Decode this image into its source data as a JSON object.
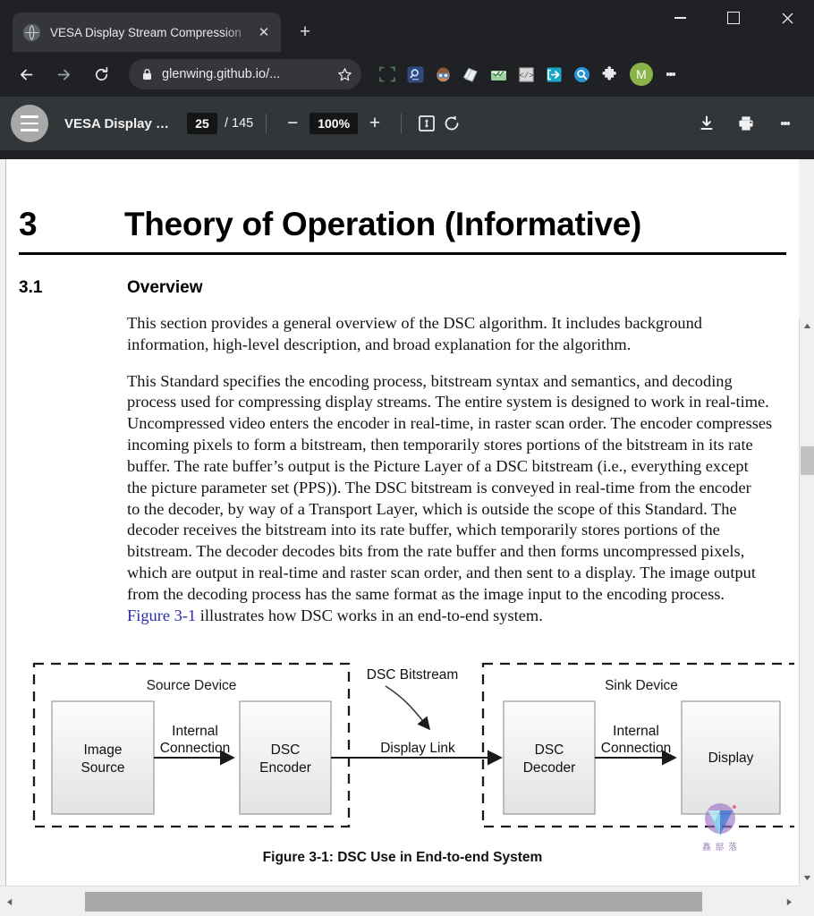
{
  "window": {
    "minimize_label": "Minimize",
    "maximize_label": "Maximize",
    "close_label": "Close"
  },
  "browser": {
    "tab": {
      "title": "VESA Display Stream Compression",
      "close_label": "✕",
      "favicon": "globe-icon"
    },
    "new_tab_label": "+",
    "nav": {
      "back": "←",
      "forward": "→",
      "reload": "⟳"
    },
    "omnibox": {
      "url": "glenwing.github.io/...",
      "lock_icon": "lock-icon",
      "bookmark_icon": "star-icon"
    },
    "extensions": [
      {
        "name": "screenshot-capture-extension",
        "glyph": ""
      },
      {
        "name": "search-extension",
        "glyph": "⌕"
      },
      {
        "name": "avatar-extension",
        "glyph": ""
      },
      {
        "name": "documents-extension",
        "glyph": ""
      },
      {
        "name": "mail-extension",
        "glyph": ""
      },
      {
        "name": "code-extension",
        "glyph": "</>"
      },
      {
        "name": "export-extension",
        "glyph": ""
      },
      {
        "name": "zoom-search-extension",
        "glyph": "⌕"
      },
      {
        "name": "puzzle-extensions-menu",
        "glyph": ""
      }
    ],
    "profile": {
      "initial": "M"
    },
    "menu_label": "⋮"
  },
  "pdf_toolbar": {
    "menu_label": "Sidebar menu",
    "document_title": "VESA Display …",
    "page_current": "25",
    "page_total": "/ 145",
    "zoom_out_label": "−",
    "zoom_level": "100%",
    "zoom_in_label": "+",
    "fit_page_label": "fit-to-page-icon",
    "rotate_label": "rotate-icon",
    "download_label": "download-icon",
    "print_label": "print-icon",
    "more_label": "⋮"
  },
  "document": {
    "heading1": {
      "number": "3",
      "text": "Theory of Operation (Informative)"
    },
    "heading2": {
      "number": "3.1",
      "text": "Overview"
    },
    "paragraphs": [
      {
        "lines": [
          "This section provides a general overview of the DSC algorithm. It includes background",
          "information, high-level description, and broad explanation for the algorithm."
        ]
      },
      {
        "lines": [
          "This Standard specifies the encoding process, bitstream syntax and semantics, and decoding",
          "process used for compressing display streams. The entire system is designed to work in real-time.",
          "Uncompressed video enters the encoder in real-time, in raster scan order. The encoder compresses",
          "incoming pixels to form a bitstream, then temporarily stores portions of the bitstream in its rate",
          "buffer. The rate buffer’s output is the Picture Layer of a DSC bitstream (i.e., everything except",
          "the picture parameter set (PPS)). The DSC bitstream is conveyed in real-time from the encoder",
          "to the decoder, by way of a Transport Layer, which is outside the scope of this Standard. The",
          "decoder receives the bitstream into its rate buffer, which temporarily stores portions of the",
          "bitstream. The decoder decodes bits from the rate buffer and then forms uncompressed pixels,",
          "which are output in real-time and raster scan order, and then sent to a display. The image output",
          "from the decoding process has the same format as the image input to the encoding process."
        ]
      }
    ],
    "figure_ref_line": {
      "link": "Figure 3-1",
      "rest": " illustrates how DSC works in an end-to-end system."
    },
    "figure": {
      "caption": "Figure 3-1: DSC Use in End-to-end System",
      "source_group_label": "Source Device",
      "sink_group_label": "Sink Device",
      "blocks": [
        {
          "name": "image-source-block",
          "line1": "Image",
          "line2": "Source"
        },
        {
          "name": "dsc-encoder-block",
          "line1": "DSC",
          "line2": "Encoder"
        },
        {
          "name": "dsc-decoder-block",
          "line1": "DSC",
          "line2": "Decoder"
        },
        {
          "name": "display-block",
          "line1": "Display",
          "line2": ""
        }
      ],
      "edge_labels": [
        {
          "name": "internal-connection-left",
          "line1": "Internal",
          "line2": "Connection"
        },
        {
          "name": "dsc-bitstream-label",
          "line1": "DSC Bitstream",
          "line2": ""
        },
        {
          "name": "display-link-label",
          "line1": "Display Link",
          "line2": ""
        },
        {
          "name": "internal-connection-right",
          "line1": "Internal",
          "line2": "Connection"
        }
      ],
      "watermark": {
        "text": "鑫 部 落"
      }
    }
  },
  "colors": {
    "chrome_bg": "#202124",
    "tab_active": "#35363a",
    "pdf_toolbar": "#323639",
    "page_bg": "#ffffff",
    "link": "#2b2bb0",
    "profile": "#8ab44a",
    "scroll_thumb": "#a8a8a8"
  }
}
